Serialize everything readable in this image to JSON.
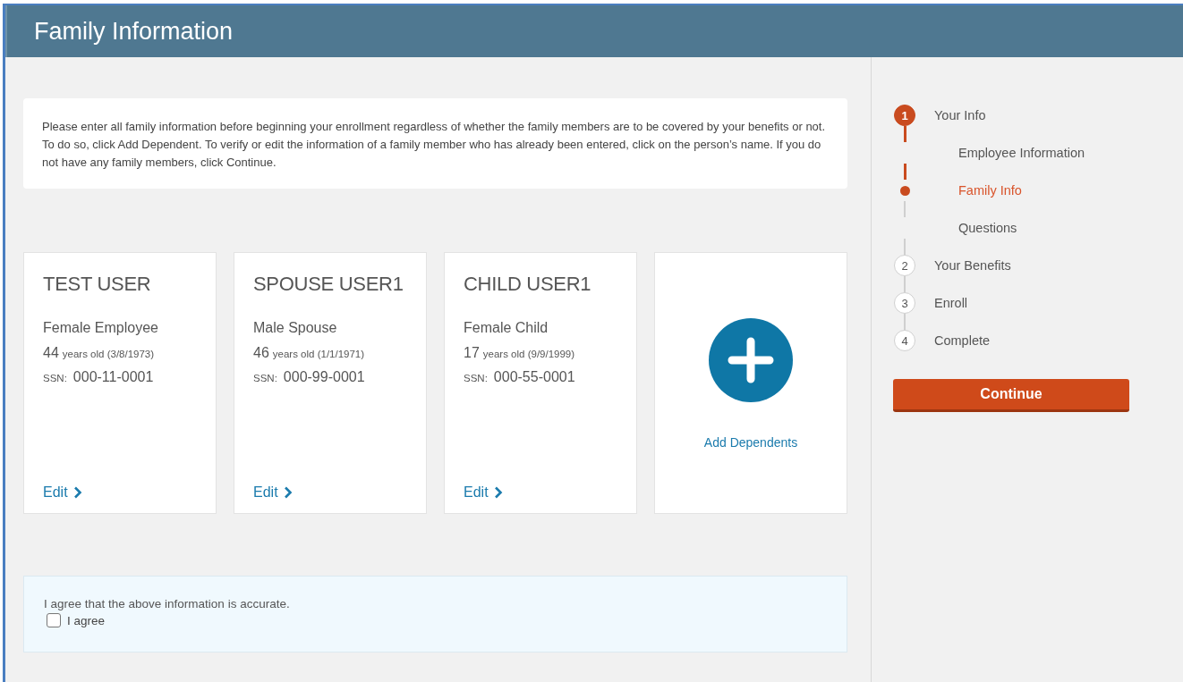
{
  "header": {
    "title": "Family Information"
  },
  "intro": "Please enter all family information before beginning your enrollment regardless of whether the family members are to be covered by your benefits or not. To do so, click Add Dependent. To verify or edit the information of a family member who has already been entered, click on the person’s name. If you do not have any family members, click Continue.",
  "members": [
    {
      "name": "TEST USER",
      "description": "Female Employee",
      "age": "44",
      "age_detail": "years old (3/8/1973)",
      "ssn_label": "SSN:",
      "ssn": "000-11-0001",
      "edit": "Edit"
    },
    {
      "name": "SPOUSE USER1",
      "description": "Male Spouse",
      "age": "46",
      "age_detail": "years old (1/1/1971)",
      "ssn_label": "SSN:",
      "ssn": "000-99-0001",
      "edit": "Edit"
    },
    {
      "name": "CHILD USER1",
      "description": "Female Child",
      "age": "17",
      "age_detail": "years old (9/9/1999)",
      "ssn_label": "SSN:",
      "ssn": "000-55-0001",
      "edit": "Edit"
    }
  ],
  "add_card": {
    "label": "Add Dependents"
  },
  "agreement": {
    "text": "I agree that the above information is accurate.",
    "checkbox_label": "I agree",
    "checked": false
  },
  "steps": [
    {
      "number": "1",
      "label": "Your Info",
      "active": true,
      "children": [
        {
          "label": "Employee Information",
          "selected": false
        },
        {
          "label": "Family Info",
          "selected": true
        },
        {
          "label": "Questions",
          "selected": false
        }
      ]
    },
    {
      "number": "2",
      "label": "Your Benefits",
      "active": false
    },
    {
      "number": "3",
      "label": "Enroll",
      "active": false
    },
    {
      "number": "4",
      "label": "Complete",
      "active": false
    }
  ],
  "continue_button": "Continue"
}
